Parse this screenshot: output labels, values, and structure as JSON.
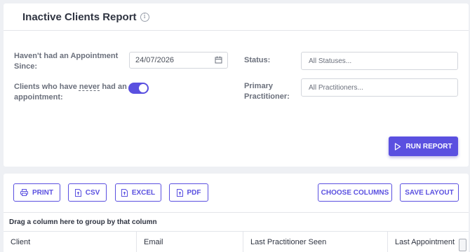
{
  "header": {
    "title": "Inactive Clients Report",
    "info_icon": "info-icon"
  },
  "filters": {
    "since_label_line1": "Haven't had an Appointment",
    "since_label_line2": "Since:",
    "since_value": "24/07/2026",
    "never_label_prefix": "Clients who have ",
    "never_label_emph": "never",
    "never_label_suffix": " had an",
    "never_label_line2": "appointment:",
    "never_toggle_on": true,
    "status_label": "Status:",
    "status_value": "All Statuses...",
    "practitioner_label_line1": "Primary",
    "practitioner_label_line2": "Practitioner:",
    "practitioner_value": "All Practitioners..."
  },
  "run_button": {
    "label": "RUN REPORT",
    "icon": "play-outline-icon"
  },
  "toolbar": {
    "print": "PRINT",
    "csv": "CSV",
    "excel": "EXCEL",
    "pdf": "PDF",
    "choose_columns": "CHOOSE COLUMNS",
    "save_layout": "SAVE LAYOUT"
  },
  "grid": {
    "group_hint": "Drag a column here to group by that column",
    "columns": [
      "Client",
      "Email",
      "Last Practitioner Seen",
      "Last Appointment"
    ]
  },
  "colors": {
    "accent": "#5a50e0",
    "background": "#eef0f4"
  }
}
